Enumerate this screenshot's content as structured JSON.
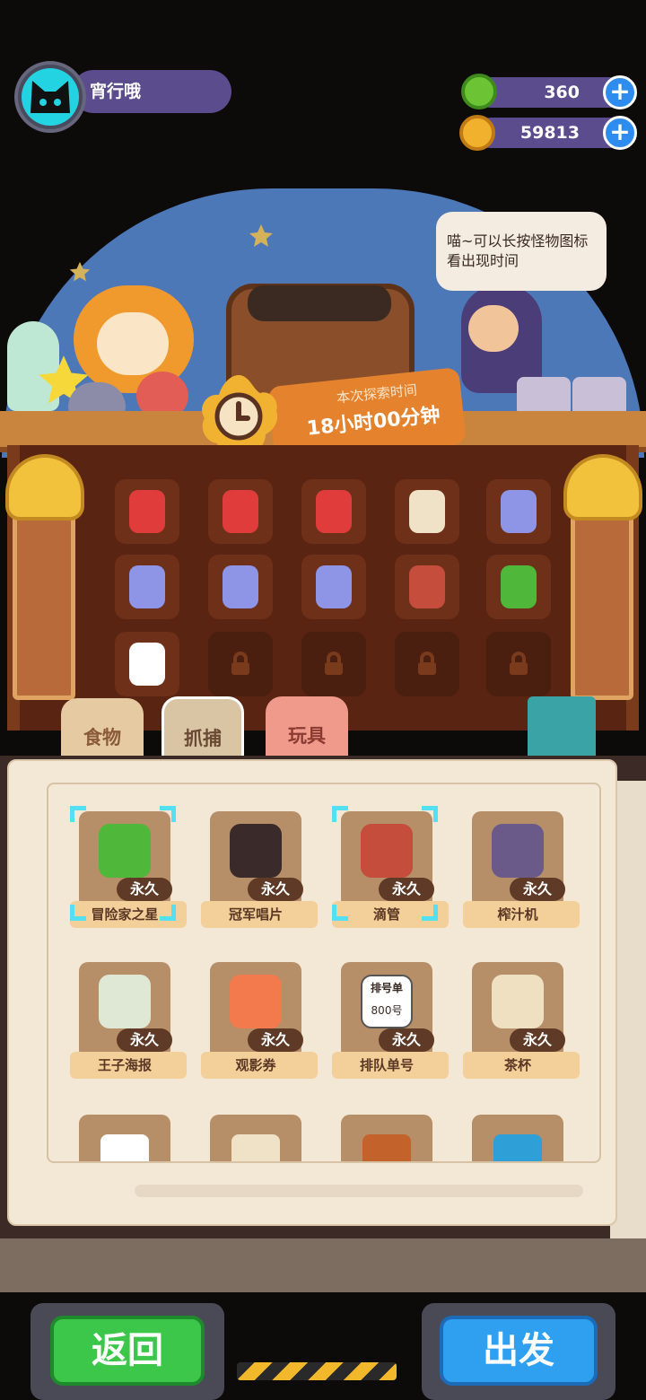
{
  "player": {
    "name": "宵行哦"
  },
  "currencies": [
    {
      "name": "green-gem",
      "value": "360",
      "color": "#7ad63a"
    },
    {
      "name": "gold-planet",
      "value": "59813",
      "color": "#f4b32c"
    }
  ],
  "speech": {
    "text": "喵~可以长按怪物图标看出现时间"
  },
  "timer": {
    "label": "本次探索时间",
    "value": "18小时00分钟"
  },
  "backpack_slots": [
    {
      "icon": "fried-chicken-bucket-icon",
      "locked": false
    },
    {
      "icon": "fried-chicken-bucket-icon",
      "locked": false
    },
    {
      "icon": "fried-chicken-bucket-icon",
      "locked": false
    },
    {
      "icon": "ticket-note-icon",
      "locked": false
    },
    {
      "icon": "potion-bottle-icon",
      "locked": false
    },
    {
      "icon": "potion-bottle-icon",
      "locked": false
    },
    {
      "icon": "potion-bottle-icon",
      "locked": false
    },
    {
      "icon": "potion-bottle-icon",
      "locked": false
    },
    {
      "icon": "dropper-icon",
      "locked": false
    },
    {
      "icon": "adventurer-star-icon",
      "locked": false
    },
    {
      "icon": "heart-card-icon",
      "locked": false
    },
    {
      "icon": "lock-icon",
      "locked": true
    },
    {
      "icon": "lock-icon",
      "locked": true
    },
    {
      "icon": "lock-icon",
      "locked": true
    },
    {
      "icon": "lock-icon",
      "locked": true
    }
  ],
  "tabs": [
    {
      "label": "食物"
    },
    {
      "label": "抓捕"
    },
    {
      "label": "玩具"
    }
  ],
  "items": [
    {
      "name": "冒险家之星",
      "badge": "永久",
      "icon": "adventurer-star-icon",
      "selected": true
    },
    {
      "name": "冠军唱片",
      "badge": "永久",
      "icon": "record-icon",
      "selected": false
    },
    {
      "name": "滴管",
      "badge": "永久",
      "icon": "dropper-icon",
      "selected": true
    },
    {
      "name": "榨汁机",
      "badge": "永久",
      "icon": "juicer-icon",
      "selected": false
    },
    {
      "name": "王子海报",
      "badge": "永久",
      "icon": "poster-icon",
      "selected": false
    },
    {
      "name": "观影券",
      "badge": "永久",
      "icon": "movie-ticket-icon",
      "selected": false
    },
    {
      "name": "排队单号",
      "badge": "永久",
      "icon": "queue-ticket-icon",
      "selected": false
    },
    {
      "name": "茶杯",
      "badge": "永久",
      "icon": "teacup-icon",
      "selected": false
    }
  ],
  "queue_ticket": {
    "title": "排号单",
    "number": "800号"
  },
  "buttons": {
    "back": "返回",
    "go": "出发"
  }
}
